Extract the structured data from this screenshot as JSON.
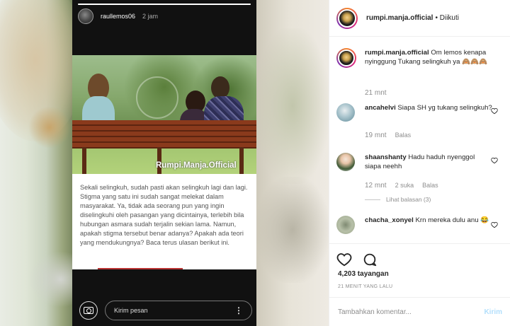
{
  "story": {
    "username": "raullemos06",
    "time": "2 jam",
    "watermark": "Rumpi.Manja.Official",
    "text": "Sekali selingkuh, sudah pasti akan selingkuh lagi dan lagi. Stigma yang satu ini sudah sangat melekat dalam masyarakat. Ya, tidak ada seorang pun yang ingin diselingkuhi oleh pasangan yang dicintainya, terlebih bila hubungan asmara sudah terjalin sekian lama. Namun, apakah stigma tersebut benar adanya? Apakah ada teori yang mendukungnya? Baca terus ulasan berikut ini.",
    "message_placeholder": "Kirim pesan",
    "more_glyph": "⋮",
    "progress": 1.0
  },
  "panel": {
    "header": {
      "username": "rumpi.manja.official",
      "follow_status": "• Diikuti"
    },
    "caption": {
      "username": "rumpi.manja.official",
      "text": "Om lemos kenapa nyinggung Tukang selingkuh ya 🙈🙈🙈",
      "time": "21 mnt"
    },
    "comments": [
      {
        "username": "ancahelvi",
        "text": "Siapa SH yg tukang selingkuh?",
        "time": "19 mnt",
        "reply": "Balas"
      },
      {
        "username": "shaanshanty",
        "text": "Hadu haduh nyenggol siapa neehh",
        "time": "12 mnt",
        "likes": "2 suka",
        "reply": "Balas",
        "view_replies": "Lihat balasan (3)"
      },
      {
        "username": "chacha_xonyel",
        "text": "Krn mereka dulu anu 😂"
      }
    ],
    "views": "4,203 tayangan",
    "posted": "21 MENIT YANG LALU",
    "add_comment_placeholder": "Tambahkan komentar...",
    "send_label": "Kirim"
  }
}
